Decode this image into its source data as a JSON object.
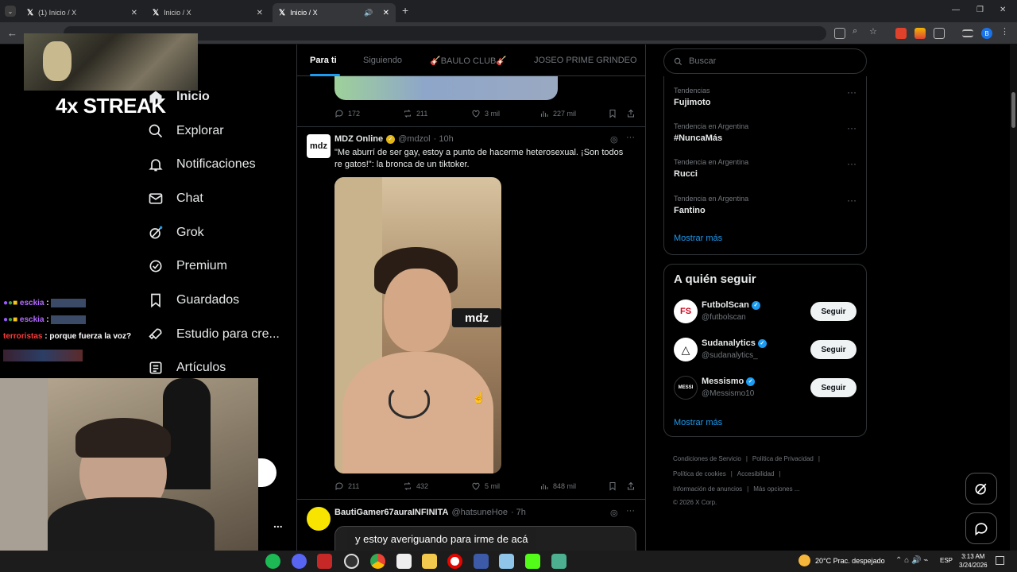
{
  "browser": {
    "tabs": [
      {
        "title": "(1) Inicio / X",
        "active": false
      },
      {
        "title": "Inicio / X",
        "active": false
      },
      {
        "title": "Inicio / X",
        "active": true
      }
    ],
    "new_tab_symbol": "+",
    "window_controls": [
      "—",
      "❐",
      "✕"
    ]
  },
  "overlay": {
    "streak_text": "4x STREAK"
  },
  "sidebar": {
    "items": [
      {
        "label": "Inicio",
        "icon": "home-icon"
      },
      {
        "label": "Explorar",
        "icon": "search-icon"
      },
      {
        "label": "Notificaciones",
        "icon": "bell-icon"
      },
      {
        "label": "Chat",
        "icon": "mail-icon"
      },
      {
        "label": "Grok",
        "icon": "grok-icon"
      },
      {
        "label": "Premium",
        "icon": "premium-icon"
      },
      {
        "label": "Guardados",
        "icon": "bookmark-icon"
      },
      {
        "label": "Estudio para cre...",
        "icon": "rocket-icon"
      },
      {
        "label": "Artículos",
        "icon": "article-icon"
      }
    ],
    "more_symbol": "..."
  },
  "stream_chat": [
    {
      "user": "esckia",
      "text": ":",
      "color": "#b36bff"
    },
    {
      "user": "esckia",
      "text": ":",
      "color": "#b36bff"
    },
    {
      "user": "terroristas",
      "text": ": porque fuerza la voz?",
      "color": "#ff3b3b"
    }
  ],
  "feed": {
    "tabs": [
      "Para ti",
      "Siguiendo",
      "🎸BAULO CLUB🎸",
      "JOSEO PRIME GRINDEO"
    ],
    "prev_post_actions": {
      "replies": "172",
      "reposts": "211",
      "likes": "3 mil",
      "views": "227 mil"
    },
    "post": {
      "author": "MDZ Online",
      "handle": "@mdzol",
      "time": "· 10h",
      "avatar_text": "mdz",
      "text": "\"Me aburrí de ser gay, estoy a punto de hacerme heterosexual. ¡Son todos re gatos!\": la bronca de un tiktoker.",
      "media_watermark": "mdz",
      "actions": {
        "replies": "211",
        "reposts": "432",
        "likes": "5 mil",
        "views": "848 mil"
      }
    },
    "next_post": {
      "author": "BautiGamer67auraINFINITA",
      "handle": "@hatsuneHoe",
      "time": "· 7h"
    },
    "caption": "y estoy averiguando para irme de acá"
  },
  "right": {
    "search_placeholder": "Buscar",
    "trends": [
      {
        "category": "Tendencias",
        "name": "Fujimoto"
      },
      {
        "category": "Tendencia en Argentina",
        "name": "#NuncaMás"
      },
      {
        "category": "Tendencia en Argentina",
        "name": "Rucci"
      },
      {
        "category": "Tendencia en Argentina",
        "name": "Fantino"
      }
    ],
    "trends_more": "Mostrar más",
    "who_to_follow": {
      "title": "A quién seguir",
      "accounts": [
        {
          "name": "FutbolScan",
          "handle": "@futbolscan",
          "button": "Seguir"
        },
        {
          "name": "Sudanalytics",
          "handle": "@sudanalytics_",
          "button": "Seguir"
        },
        {
          "name": "Messismo",
          "handle": "@Messismo10",
          "button": "Seguir"
        }
      ],
      "more": "Mostrar más"
    },
    "footer": {
      "line1": [
        "Condiciones de Servicio",
        "Política de Privacidad"
      ],
      "line2": [
        "Política de cookies",
        "Accesibilidad"
      ],
      "line3": [
        "Información de anuncios",
        "Más opciones ..."
      ],
      "copyright": "© 2026 X Corp."
    }
  },
  "taskbar": {
    "weather": "20°C  Prac. despejado",
    "lang": "ESP",
    "time": "3:13 AM",
    "date": "3/24/2026"
  }
}
